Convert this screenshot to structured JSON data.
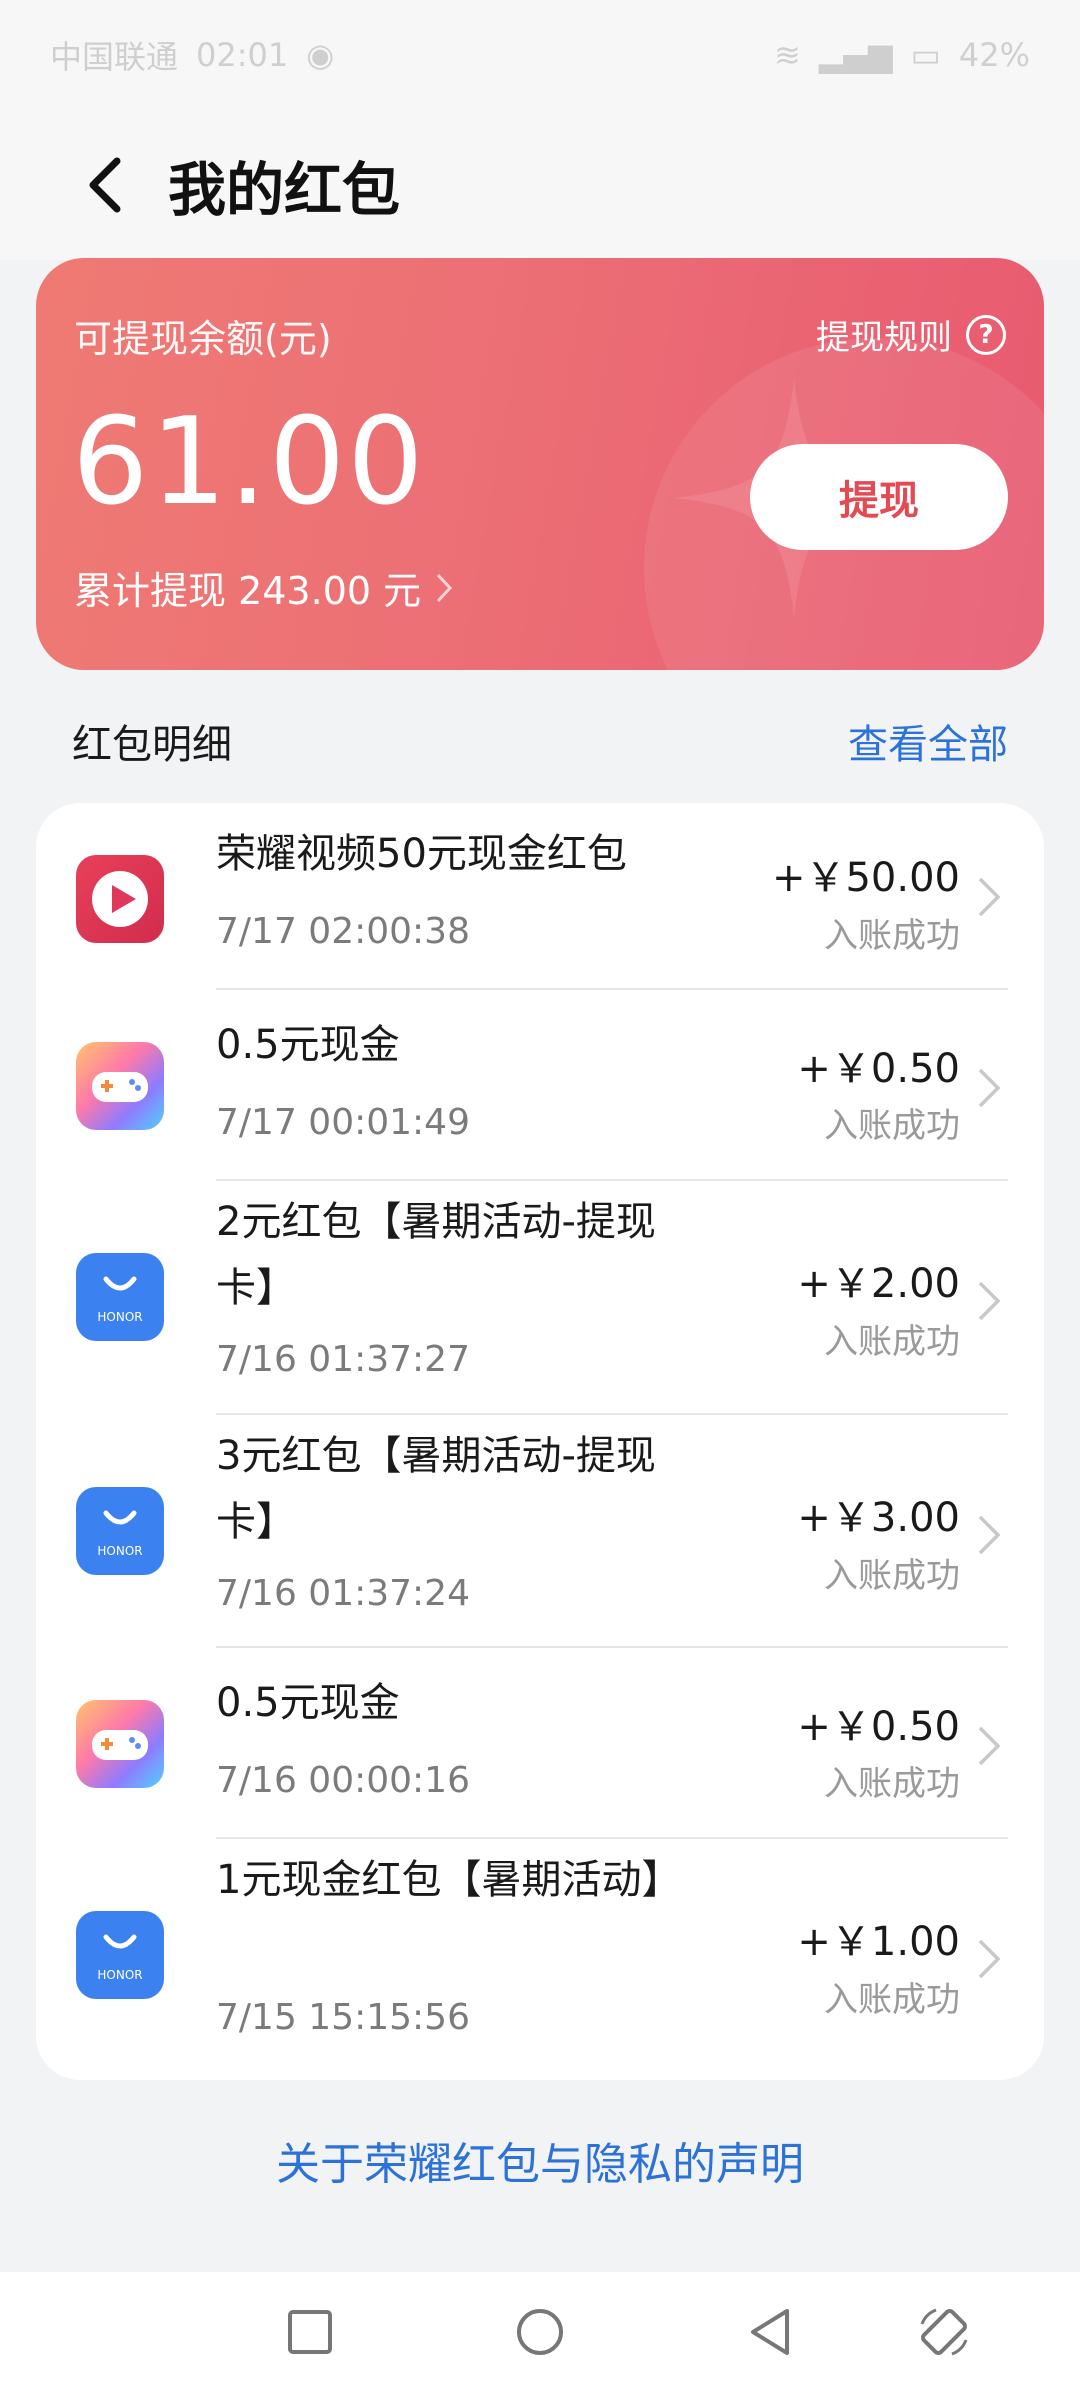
{
  "status_bar": {
    "carrier": "中国联通",
    "time": "02:01",
    "battery": "42%"
  },
  "header": {
    "title": "我的红包"
  },
  "balance": {
    "label": "可提现余额(元)",
    "amount": "61.00",
    "rules_label": "提现规则",
    "total_withdraw": "累计提现 243.00 元",
    "withdraw_button": "提现"
  },
  "section": {
    "title": "红包明细",
    "view_all": "查看全部"
  },
  "transactions": [
    {
      "title": "荣耀视频50元现金红包",
      "time": "7/17 02:00:38",
      "amount": "+￥50.00",
      "status": "入账成功",
      "icon": "video-app-icon"
    },
    {
      "title": "0.5元现金",
      "time": "7/17 00:01:49",
      "amount": "+￥0.50",
      "status": "入账成功",
      "icon": "game-center-icon"
    },
    {
      "title": "2元红包【暑期活动-提现卡】",
      "time": "7/16 01:37:27",
      "amount": "+￥2.00",
      "status": "入账成功",
      "icon": "honor-mall-icon"
    },
    {
      "title": "3元红包【暑期活动-提现卡】",
      "time": "7/16 01:37:24",
      "amount": "+￥3.00",
      "status": "入账成功",
      "icon": "honor-mall-icon"
    },
    {
      "title": "0.5元现金",
      "time": "7/16 00:00:16",
      "amount": "+￥0.50",
      "status": "入账成功",
      "icon": "game-center-icon"
    },
    {
      "title": "1元现金红包【暑期活动】",
      "time": "7/15 15:15:56",
      "amount": "+￥1.00",
      "status": "入账成功",
      "icon": "honor-mall-icon"
    }
  ],
  "icon_text": {
    "honor": "HONOR"
  },
  "footer": {
    "privacy_link": "关于荣耀红包与隐私的声明"
  },
  "colors": {
    "accent_red": "#e34a54",
    "link_blue": "#2c72d8"
  }
}
